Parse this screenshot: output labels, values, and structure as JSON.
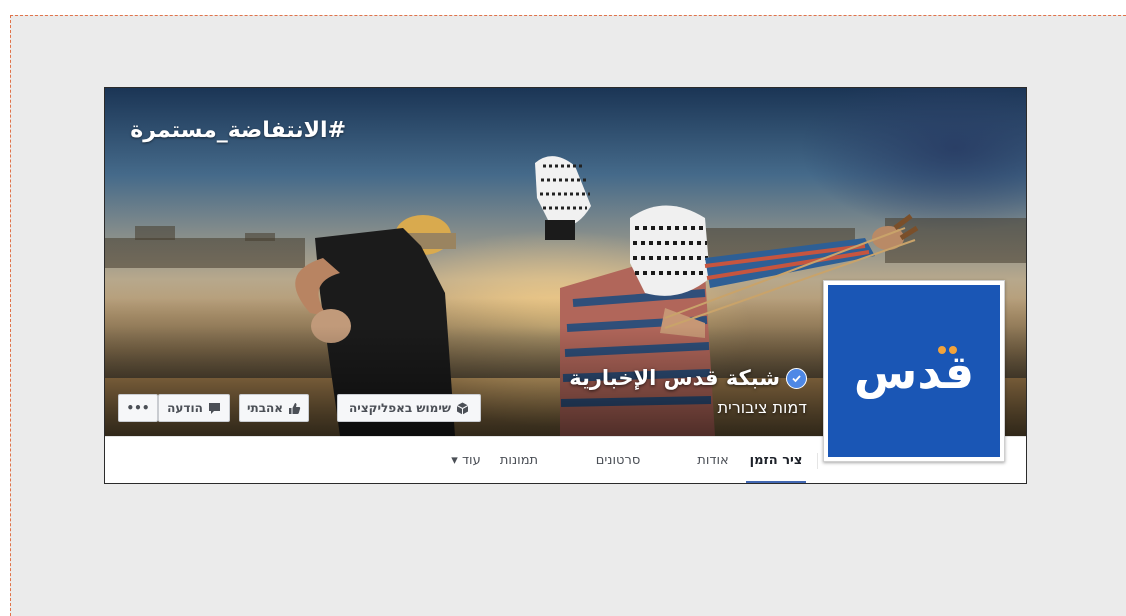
{
  "cover": {
    "hashtag": "#الانتفاضة_مستمرة"
  },
  "profile": {
    "logo_text": "قدس",
    "logo_icon": "qds-logo",
    "name": "شبكة قدس الإخبارية",
    "verified_icon": "verified-check-icon",
    "category": "דמות ציבורית",
    "brand_color": "#1a56b5"
  },
  "actions": {
    "use_app_label": "שימוש באפליקציה",
    "use_app_icon": "app-cube-icon",
    "like_label": "אהבתי",
    "like_icon": "thumbs-up-icon",
    "message_label": "הודעה",
    "message_icon": "speech-bubble-icon",
    "more_label": "•••"
  },
  "nav": {
    "tabs": [
      {
        "label": "ציר הזמן",
        "active": true
      },
      {
        "label": "אודות",
        "active": false
      },
      {
        "label": "סרטונים",
        "active": false
      },
      {
        "label": "תמונות",
        "active": false
      },
      {
        "label": "עוד ▾",
        "active": false
      }
    ],
    "accent_color": "#4267b2"
  }
}
